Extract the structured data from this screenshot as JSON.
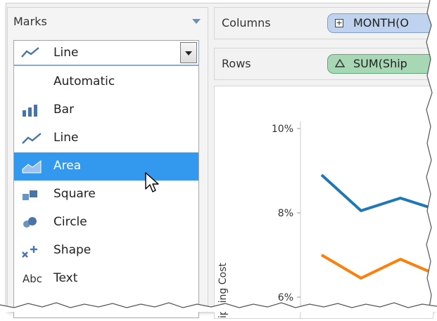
{
  "marks": {
    "header": "Marks",
    "selected_value": "Line",
    "options": [
      {
        "label": "Automatic",
        "icon": "none"
      },
      {
        "label": "Bar",
        "icon": "bar-icon"
      },
      {
        "label": "Line",
        "icon": "line-icon"
      },
      {
        "label": "Area",
        "icon": "area-icon",
        "highlighted": true
      },
      {
        "label": "Square",
        "icon": "square-icon"
      },
      {
        "label": "Circle",
        "icon": "circle-icon"
      },
      {
        "label": "Shape",
        "icon": "shape-icon"
      },
      {
        "label": "Text",
        "icon": "text-icon",
        "icon_text": "Abc"
      }
    ]
  },
  "shelves": {
    "columns_label": "Columns",
    "columns_pill": "MONTH(O",
    "rows_label": "Rows",
    "rows_pill": "SUM(Ship"
  },
  "chart_data": {
    "type": "line",
    "ylabel": "ipping Cost",
    "y_ticks": [
      "10%",
      "8%",
      "6%"
    ],
    "ylim": [
      5.5,
      10.5
    ],
    "x": [
      1,
      2,
      3,
      4
    ],
    "series": [
      {
        "values": [
          8.9,
          8.05,
          8.35,
          8.05
        ],
        "color": "#1f77b4"
      },
      {
        "values": [
          7.0,
          6.45,
          6.9,
          6.5
        ],
        "color": "#ff7f0e"
      }
    ]
  },
  "colors": {
    "selection": "#3399ee",
    "columns_pill": "#bfd3ee",
    "rows_pill": "#a8d7b6"
  }
}
